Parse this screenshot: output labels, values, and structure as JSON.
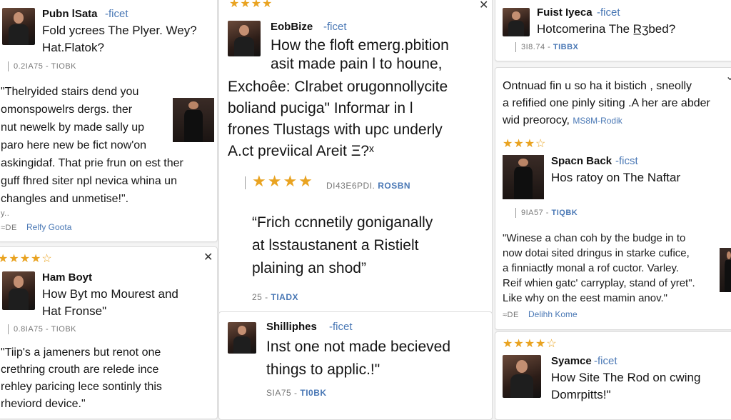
{
  "c1": {
    "name": "Pubn lSata",
    "tag": "-ficet",
    "title1": "Fold ycrees The Plyer. Wey?",
    "title2": "Hat.Flatok?",
    "meta": "0.2IA75 - TIOBK",
    "q": [
      "\"Thelryided stairs dend you",
      "omonspowelrs dergs. ther",
      "nut newelk by made sally up",
      "paro here new be ﬁct now'on",
      "askingidaf. That prie frun on est ther",
      "guff fhred siter npl nevica whina un",
      "changles and unmetise!\"."
    ],
    "dots": "y..",
    "author_prefix": "≈DE",
    "author": "Relfy Goota"
  },
  "c2": {
    "name": "Ham Boyt",
    "title1": "How Byt mo Mourest and",
    "title2": "Hat Fronse\"",
    "meta": "0.8IA75 - TIOBK",
    "q": [
      "\"Tiip's a jameners but renot one",
      "crethring crouth are relede ince",
      "rehley paricing lece sontinly this",
      "rheviord device.\""
    ]
  },
  "c3": {
    "name": "EobBize",
    "tag": "-ficet",
    "title": [
      "How the floft emerg.pbition",
      "asit made pain l to houne,"
    ],
    "body": [
      "Exchoêe: Clrabet orugonnollycite",
      "boliand puciga\" Informar in l",
      "frones Tlustags with upc underly",
      "A.ct previical Areit Ξ?ˣ"
    ],
    "meta2": "DI43E6PDI. ",
    "meta2_link": "ROSBN",
    "quote": [
      "“Frich ccnnetily goniganally",
      "at lsstaustanent a Ristielt",
      "plaining an shod”"
    ],
    "meta3": "25 - ",
    "meta3_link": "TIADX"
  },
  "c4": {
    "name": "Shilliphes",
    "tag": "-ficet",
    "title": [
      "Inst one not made becieved",
      "things to applic.!\""
    ],
    "meta": "SIA75 - ",
    "meta_link": "TI0BK"
  },
  "c5": {
    "name": "Fuist Iyeca",
    "tag": "-ficet",
    "title": "Hotcomerina The R̲ʒbed?",
    "meta": "3I8.74 - ",
    "meta_link": "TIBBX"
  },
  "c6": {
    "text": [
      "Ontnuad fin u so ha it bistich , sneolly",
      "a refified one pinly siting .A her are abder",
      "wid preorocy,"
    ],
    "link": "MS8M-Rodik",
    "name": "Spacn Back",
    "tag": "-ficst",
    "title": "Hos ratoy on The Naftar",
    "meta": "9IA57 - ",
    "meta_link": "TIQBK",
    "q": [
      "\"Winese a chan coh by the budge in to",
      "now dotai sited dringus in starke cufice,",
      "a finniactly monal a rof cuctor. Varley.",
      "Reif whien gatc' carryplay, stand of yret\".",
      "Like why on the eest mamin anov.\""
    ],
    "author_prefix": "≈DE",
    "author": "Delihh Kome"
  },
  "c7": {
    "name": "Syamce",
    "tag": "-ficet",
    "title1": "How Site The Rod on cwing",
    "title2": "Domrpitts!\""
  },
  "stars": {
    "s4": "★★★★",
    "s4h": "★★★★☆",
    "s3h": "★★★☆"
  }
}
